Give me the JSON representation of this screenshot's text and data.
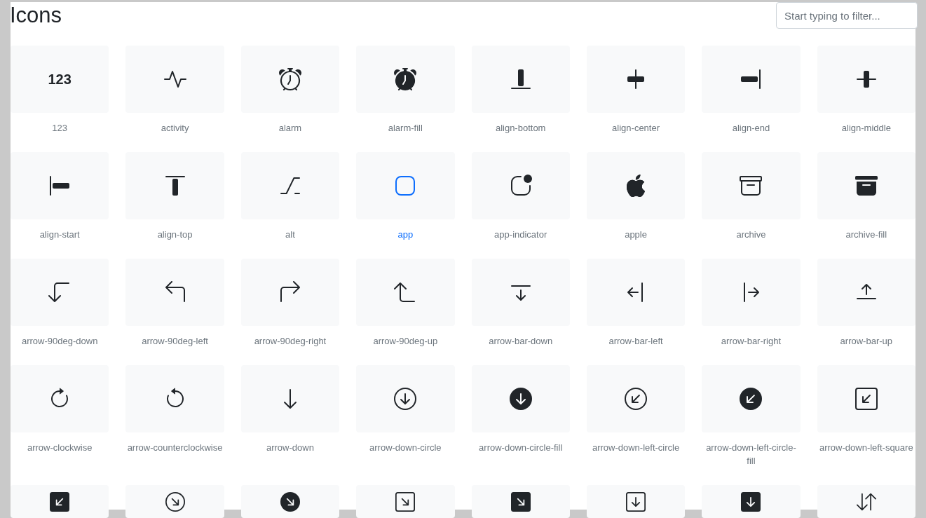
{
  "title": "Icons",
  "filter": {
    "placeholder": "Start typing to filter..."
  },
  "items": [
    {
      "label": "123",
      "selected": false,
      "glyph": "123"
    },
    {
      "label": "activity",
      "selected": false
    },
    {
      "label": "alarm",
      "selected": false
    },
    {
      "label": "alarm-fill",
      "selected": false
    },
    {
      "label": "align-bottom",
      "selected": false
    },
    {
      "label": "align-center",
      "selected": false
    },
    {
      "label": "align-end",
      "selected": false
    },
    {
      "label": "align-middle",
      "selected": false
    },
    {
      "label": "align-start",
      "selected": false
    },
    {
      "label": "align-top",
      "selected": false
    },
    {
      "label": "alt",
      "selected": false
    },
    {
      "label": "app",
      "selected": true
    },
    {
      "label": "app-indicator",
      "selected": false
    },
    {
      "label": "apple",
      "selected": false
    },
    {
      "label": "archive",
      "selected": false
    },
    {
      "label": "archive-fill",
      "selected": false
    },
    {
      "label": "arrow-90deg-down",
      "selected": false
    },
    {
      "label": "arrow-90deg-left",
      "selected": false
    },
    {
      "label": "arrow-90deg-right",
      "selected": false
    },
    {
      "label": "arrow-90deg-up",
      "selected": false
    },
    {
      "label": "arrow-bar-down",
      "selected": false
    },
    {
      "label": "arrow-bar-left",
      "selected": false
    },
    {
      "label": "arrow-bar-right",
      "selected": false
    },
    {
      "label": "arrow-bar-up",
      "selected": false
    },
    {
      "label": "arrow-clockwise",
      "selected": false
    },
    {
      "label": "arrow-counterclockwise",
      "selected": false
    },
    {
      "label": "arrow-down",
      "selected": false
    },
    {
      "label": "arrow-down-circle",
      "selected": false
    },
    {
      "label": "arrow-down-circle-fill",
      "selected": false
    },
    {
      "label": "arrow-down-left-circle",
      "selected": false
    },
    {
      "label": "arrow-down-left-circle-fill",
      "selected": false
    },
    {
      "label": "arrow-down-left-square",
      "selected": false
    },
    {
      "selected": false
    },
    {
      "selected": false
    },
    {
      "selected": false
    },
    {
      "selected": false
    },
    {
      "selected": false
    },
    {
      "selected": false
    },
    {
      "selected": false
    },
    {
      "selected": false
    }
  ]
}
